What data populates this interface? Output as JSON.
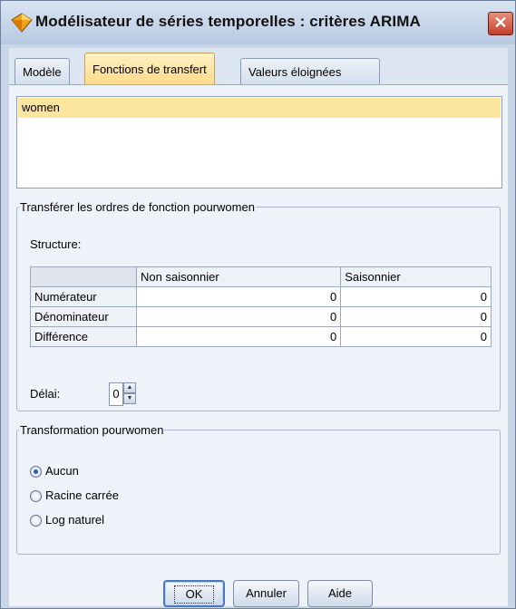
{
  "window": {
    "title": "Modélisateur de séries temporelles : critères ARIMA",
    "icon": "model-diamond-icon",
    "close_icon": "close-x-icon",
    "accent": "#2b5ea8",
    "close_color": "#c4402c"
  },
  "tabs": [
    {
      "label": "Modèle",
      "active": false
    },
    {
      "label": "Fonctions de transfert",
      "active": true
    },
    {
      "label": "Valeurs éloignées",
      "active": false
    }
  ],
  "predictors": {
    "items": [
      "women"
    ],
    "selected": "women"
  },
  "transfer_group": {
    "legend": "Transférer les ordres de fonction pourwomen",
    "structure_label": "Structure:",
    "columns": [
      "Non saisonnier",
      "Saisonnier"
    ],
    "rows": [
      {
        "label": "Numérateur",
        "values": [
          "0",
          "0"
        ]
      },
      {
        "label": "Dénominateur",
        "values": [
          "0",
          "0"
        ]
      },
      {
        "label": "Différence",
        "values": [
          "0",
          "0"
        ]
      }
    ],
    "delay_label": "Délai:",
    "delay_value": "0"
  },
  "transformation_group": {
    "legend": "Transformation pourwomen",
    "options": [
      {
        "label": "Aucun",
        "checked": true
      },
      {
        "label": "Racine carrée",
        "checked": false
      },
      {
        "label": "Log naturel",
        "checked": false
      }
    ]
  },
  "buttons": {
    "ok": "OK",
    "cancel": "Annuler",
    "help": "Aide"
  }
}
